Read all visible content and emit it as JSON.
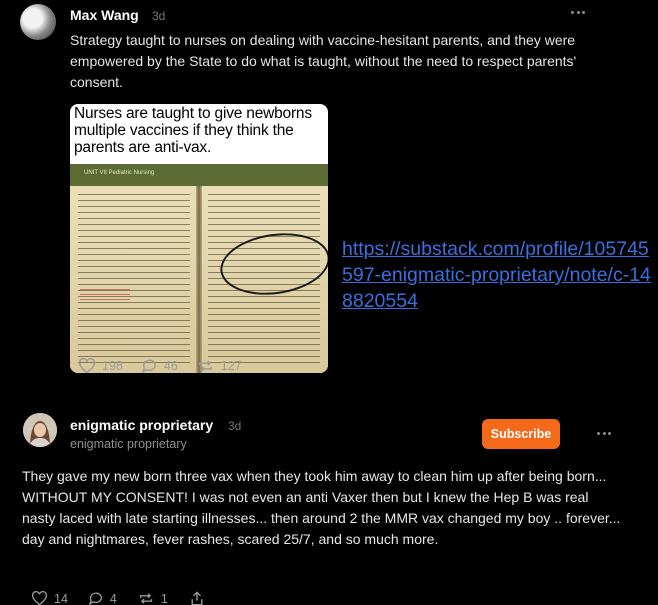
{
  "post": {
    "author": "Max Wang",
    "time": "3d",
    "text": "Strategy taught to nurses on dealing with vaccine-hesitant parents, and they were empowered by the State to do what is taught, without the need to respect parents' consent.",
    "image": {
      "caption": "Nurses are taught to give newborns multiple vaccines if they think the parents are anti-vax.",
      "page_header": "UNIT VII  Pediatric Nursing"
    },
    "link": "https://substack.com/profile/105745597-enigmatic-proprietary/note/c-148820554",
    "likes": "198",
    "comments": "46",
    "restacks": "127"
  },
  "reply": {
    "author": "enigmatic proprietary",
    "time": "3d",
    "handle": "enigmatic proprietary",
    "subscribe_label": "Subscribe",
    "text": "They gave my new born three vax when they took him away to clean him up after being born... WITHOUT MY CONSENT! I was not even an anti Vaxer then but I knew the Hep B was real nasty laced with late starting illnesses... then around 2 the MMR vax changed my boy .. forever... day and nightmares, fever rashes, scared 25/7, and so much more.",
    "likes": "14",
    "comments": "4",
    "restacks": "1"
  },
  "icons": {
    "like": "heart-icon",
    "comment": "comment-bubble-icon",
    "restack": "restack-arrows-icon",
    "share": "share-icon",
    "more": "more-dots-icon"
  },
  "colors": {
    "background": "#000000",
    "subscribe": "#f56a1a",
    "link": "#3b6fe0"
  }
}
